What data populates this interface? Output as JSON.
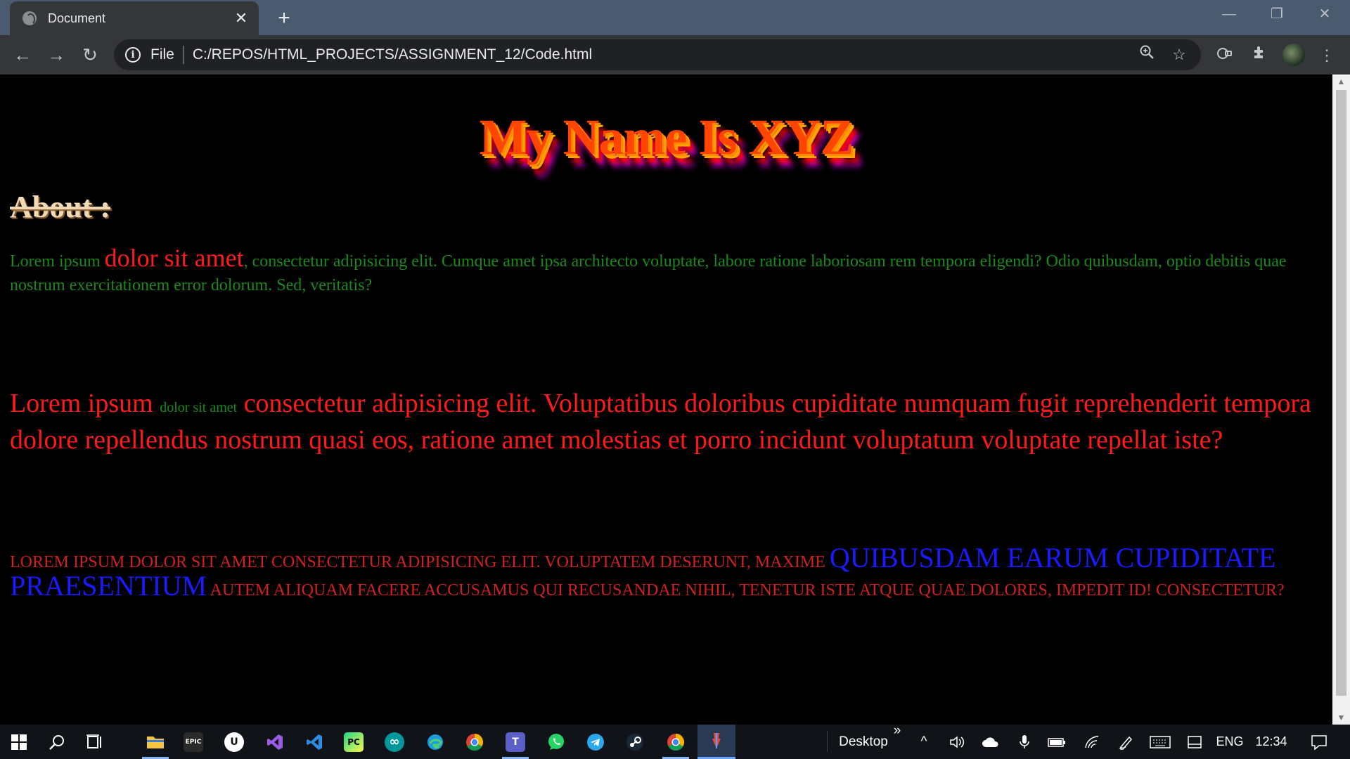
{
  "browser": {
    "tab_title": "Document",
    "tab_close": "✕",
    "new_tab": "+",
    "window_controls": {
      "minimize": "—",
      "restore": "❐",
      "close": "✕"
    },
    "nav": {
      "back": "←",
      "forward": "→",
      "reload": "↻"
    },
    "address": {
      "info": "i",
      "scheme": "File",
      "url": "C:/REPOS/HTML_PROJECTS/ASSIGNMENT_12/Code.html"
    },
    "icons": {
      "zoom": "🔍",
      "bookmark": "☆",
      "extension1": "⊘",
      "extensions": "✤",
      "menu": "⋮"
    }
  },
  "page": {
    "heading": "My Name Is XYZ",
    "about_heading": "About :",
    "p1": {
      "start": "Lorem ipsum ",
      "big": "dolor sit amet",
      "end": ", consectetur adipisicing elit. Cumque amet ipsa architecto voluptate, labore ratione laboriosam rem tempora eligendi? Odio quibusdam, optio debitis quae nostrum exercitationem error dolorum. Sed, veritatis?"
    },
    "p2": {
      "start": "Lorem ipsum ",
      "small": "dolor sit amet",
      "end": " consectetur adipisicing elit. Voluptatibus doloribus cupiditate numquam fugit reprehenderit tempora dolore repellendus nostrum quasi eos, ratione amet molestias et porro incidunt voluptatum voluptate repellat iste?"
    },
    "p3": {
      "start": "Lorem ipsum dolor sit amet consectetur adipisicing elit. Voluptatem deserunt, maxime ",
      "blue": "quibusdam earum cupiditate praesentium",
      "end": " autem aliquam facere accusamus qui recusandae nihil, tenetur iste atque quae dolores, impedit id! Consectetur?"
    }
  },
  "taskbar": {
    "apps": [
      "start",
      "search",
      "task-view",
      "file-explorer",
      "epic-games",
      "unreal-engine",
      "visual-studio",
      "vs-code",
      "pycharm",
      "arduino",
      "edge",
      "chrome",
      "teams",
      "whatsapp",
      "telegram",
      "steam",
      "chrome",
      "pin-app"
    ],
    "app_glyphs": {
      "epic": "EPIC",
      "unreal": "U",
      "pycharm": "PC",
      "arduino": "∞",
      "teams": "T"
    },
    "desktop_label": "Desktop",
    "overflow": "»",
    "tray_up": "^",
    "language": "ENG",
    "time": "12:34"
  }
}
